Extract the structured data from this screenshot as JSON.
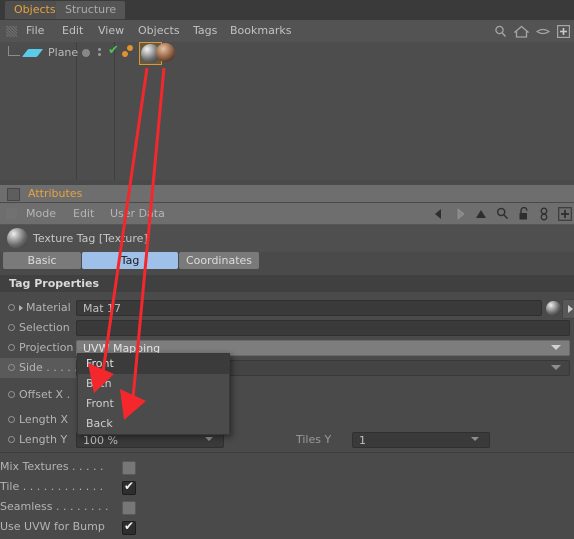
{
  "object_manager": {
    "tabs": [
      {
        "label": "Objects",
        "active": true
      },
      {
        "label": "Structure",
        "active": false
      }
    ],
    "menu": [
      "File",
      "Edit",
      "View",
      "Objects",
      "Tags",
      "Bookmarks"
    ],
    "menu_icons": [
      "search-icon",
      "home-icon",
      "eye-icon",
      "plus-icon"
    ],
    "tree": [
      {
        "name": "Plane",
        "icon": "plane-object-icon",
        "visibility_dot": "grey-dot",
        "enable_check": "green-check",
        "layer_icon": "orange-dots-icon",
        "tags": [
          {
            "name": "texture-tag-1",
            "selected": true
          },
          {
            "name": "texture-tag-2",
            "selected": false
          }
        ]
      }
    ]
  },
  "attributes": {
    "title": "Attributes",
    "menu": [
      "Mode",
      "Edit",
      "User Data"
    ],
    "nav_icons": [
      "back-arrow-icon",
      "forward-arrow-icon",
      "up-arrow-icon",
      "search-icon",
      "lock-icon",
      "chain-icon",
      "plus-icon"
    ],
    "object_header": "Texture Tag [Texture]",
    "tabs": [
      {
        "label": "Basic",
        "active": false
      },
      {
        "label": "Tag",
        "active": true
      },
      {
        "label": "Coordinates",
        "active": false
      }
    ],
    "section_title": "Tag Properties",
    "properties": [
      {
        "label": "Material",
        "value": "Mat 17",
        "type": "link"
      },
      {
        "label": "Selection",
        "value": "",
        "type": "text"
      },
      {
        "label": "Projection",
        "value": "UVW Mapping",
        "type": "dropdown"
      },
      {
        "label": "Side . . . . . .",
        "value": "Front",
        "type": "dropdown"
      },
      {
        "label": "Offset X .",
        "value": "",
        "type": "number"
      },
      {
        "label": "Length X",
        "value": "",
        "type": "number"
      },
      {
        "label": "Length Y",
        "value": "100 %",
        "type": "number",
        "extra_label": "Tiles Y",
        "extra_value": "1"
      }
    ],
    "checkboxes": [
      {
        "label": "Mix Textures . . . . .",
        "checked": false
      },
      {
        "label": "Tile . . . . . . . . . . . .",
        "checked": true
      },
      {
        "label": "Seamless . . . . . . . .",
        "checked": false
      },
      {
        "label": "Use UVW for Bump",
        "checked": true
      }
    ],
    "side_dropdown": {
      "current": "Front",
      "options": [
        "Both",
        "Front",
        "Back"
      ]
    }
  },
  "annotations": {
    "color": "#f4282c",
    "arrow_count": 2
  }
}
